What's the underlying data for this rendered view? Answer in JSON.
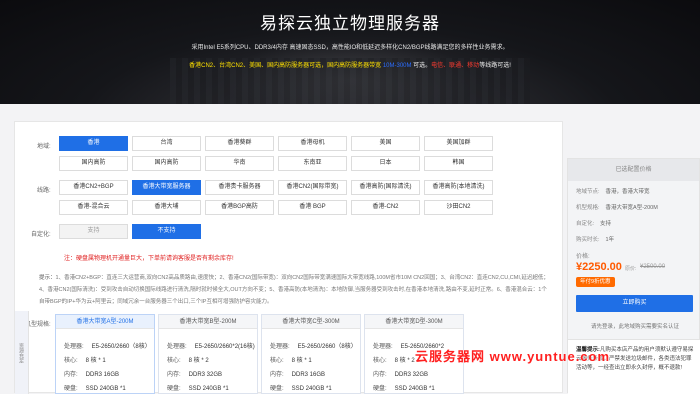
{
  "hero": {
    "title": "易探云独立物理服务器",
    "subtitle": "采用Intel E5系列CPU、DDR3/4内存 高速固态SSD，高性能IO和低延迟多样化CN2/BGP线路满足您的多样性业务需求。",
    "line_parts": [
      {
        "text": "香港CN2、台湾CN2、美国、国内高防服务器可选，国内高防服务器带宽 ",
        "cls": "hl"
      },
      {
        "text": "10M-300M",
        "cls": "hb"
      },
      {
        "text": " 可选。",
        "cls": ""
      },
      {
        "text": "电信、联通、移动",
        "cls": "hr"
      },
      {
        "text": "等线路可选!",
        "cls": ""
      }
    ]
  },
  "region": {
    "label": "地域:",
    "options": [
      "香港",
      "台湾",
      "香港葵群",
      "香港母机",
      "美国",
      "美国加群",
      "国内高防",
      "国内高防",
      "华南",
      "东南亚",
      "日本",
      "韩国"
    ],
    "selected": 0
  },
  "line": {
    "label": "线路:",
    "options": [
      "香港CN2+BGP",
      "香港大带宽服务器",
      "香港贵卡服务器",
      "香港CN2(国际带宽)",
      "香港高防(国际清洗)",
      "香港高防(本地清洗)",
      "香港-混合云",
      "香港大埔",
      "香港BGP高防",
      "香港 BGP",
      "香港-CN2",
      "沙田CN2"
    ],
    "selected": 1
  },
  "custom": {
    "label": "自定化:",
    "options": [
      "支持",
      "不支持"
    ],
    "selected": 1
  },
  "notice": "注：硬盘属物理机开通量巨大，下单前请询客服是否有剩余库存!",
  "tip": {
    "label": "提示：",
    "text": "1、香港CN2+BGP：直连三大运营商,双向CN2高品质路由,速度快；2、香港CN2(国际带宽)：双向CN2国际带宽满速国际大带宽线路,100M省市10M CN2回国；3、台湾CN2：直连CN2,CU,CMI,延迟超低；4、香港CN2(国际清洗)：受到攻击自动切换国际线路进行清洗,隔时就时候全大,OUT方向不变；5、香港高防(本地清洗)：本地防御,当服务器受到攻击时,在香港本地清洗,路由不变,延时正常。6、香港混合云：1个自带BGP的IP+华为云+阿里云；同域冗余一台服务器三个出口,三个IP互相可增强防护容灾能力。"
  },
  "model": {
    "label": "机型规格:",
    "side_tab": "资源充足",
    "cards": [
      {
        "name": "香港大带宽A型-200M",
        "cpu": "E5-2650/2660（8核）",
        "cores": "8 核 * 1",
        "ram": "DDR3 16GB",
        "disk": "SSD 240GB *1"
      },
      {
        "name": "香港大带宽B型-200M",
        "cpu": "E5-2650/2660*2(16核)",
        "cores": "8 核 * 2",
        "ram": "DDR3 32GB",
        "disk": "SSD 240GB *1"
      },
      {
        "name": "香港大带宽C型-300M",
        "cpu": "E5-2650/2660（8核）",
        "cores": "8 核 * 1",
        "ram": "DDR3 16GB",
        "disk": "SSD 240GB *1"
      },
      {
        "name": "香港大带宽D型-300M",
        "cpu": "E5-2650/2660*2",
        "cores": "8 核 * 2",
        "ram": "DDR3 32GB",
        "disk": "SSD 240GB *1"
      }
    ],
    "keys": {
      "cpu": "处理器:",
      "cores": "核心:",
      "ram": "内存:",
      "disk": "硬盘:"
    },
    "selected": 0
  },
  "summary": {
    "header": "已选配置价格",
    "specs": [
      {
        "k": "地域节点:",
        "v": "香港，香港大带宽"
      },
      {
        "k": "机型规格:",
        "v": "香港大带宽A型-200M"
      },
      {
        "k": "自定化:",
        "v": "支持"
      },
      {
        "k": "购买时长:",
        "v": "1年"
      }
    ],
    "price_label": "价格:",
    "price": "¥2250.00",
    "old_label": "原价:",
    "old_price": "¥2500.00",
    "promo": "年付9折优惠",
    "buy": "立即购买",
    "note": "请先登录，此地域购买需要实名认证",
    "warm_title": "温馨提示:",
    "warm_text": "凡购买本店产品的用户须默认遵守易探云服务条款，严禁发送垃圾邮件，各类违法犯罪活动等，一经查出立即永久封停，概不退款!"
  },
  "watermark": "云服务器网 www.yuntue.com"
}
